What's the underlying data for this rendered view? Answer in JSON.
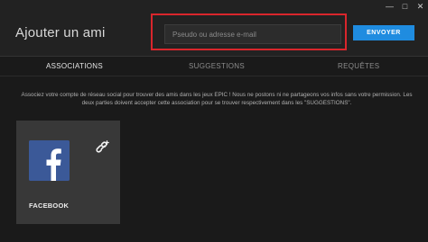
{
  "window": {
    "controls": {
      "minimize": "—",
      "maximize": "□",
      "close": "✕"
    }
  },
  "header": {
    "title": "Ajouter un ami",
    "search": {
      "placeholder": "Pseudo ou adresse e-mail",
      "value": ""
    },
    "send_label": "ENVOYER"
  },
  "tabs": [
    {
      "label": "ASSOCIATIONS",
      "active": true
    },
    {
      "label": "SUGGESTIONS",
      "active": false
    },
    {
      "label": "REQUÊTES",
      "active": false
    }
  ],
  "main": {
    "description": "Associez votre compte de réseau social pour trouver des amis dans les jeux EPIC ! Nous ne postons ni ne partageons vos infos sans votre permission. Les deux parties doivent accepter cette association pour se trouver respectivement dans les \"SUGGESTIONS\".",
    "social_card": {
      "label": "FACEBOOK",
      "icon": "facebook-icon",
      "link_icon": "link-icon"
    }
  },
  "colors": {
    "accent": "#1f8ce0",
    "highlight": "#d9262c",
    "facebook": "#3b5998",
    "background": "#1a1a1a",
    "header_bg": "#222222",
    "card_bg": "#383838"
  }
}
